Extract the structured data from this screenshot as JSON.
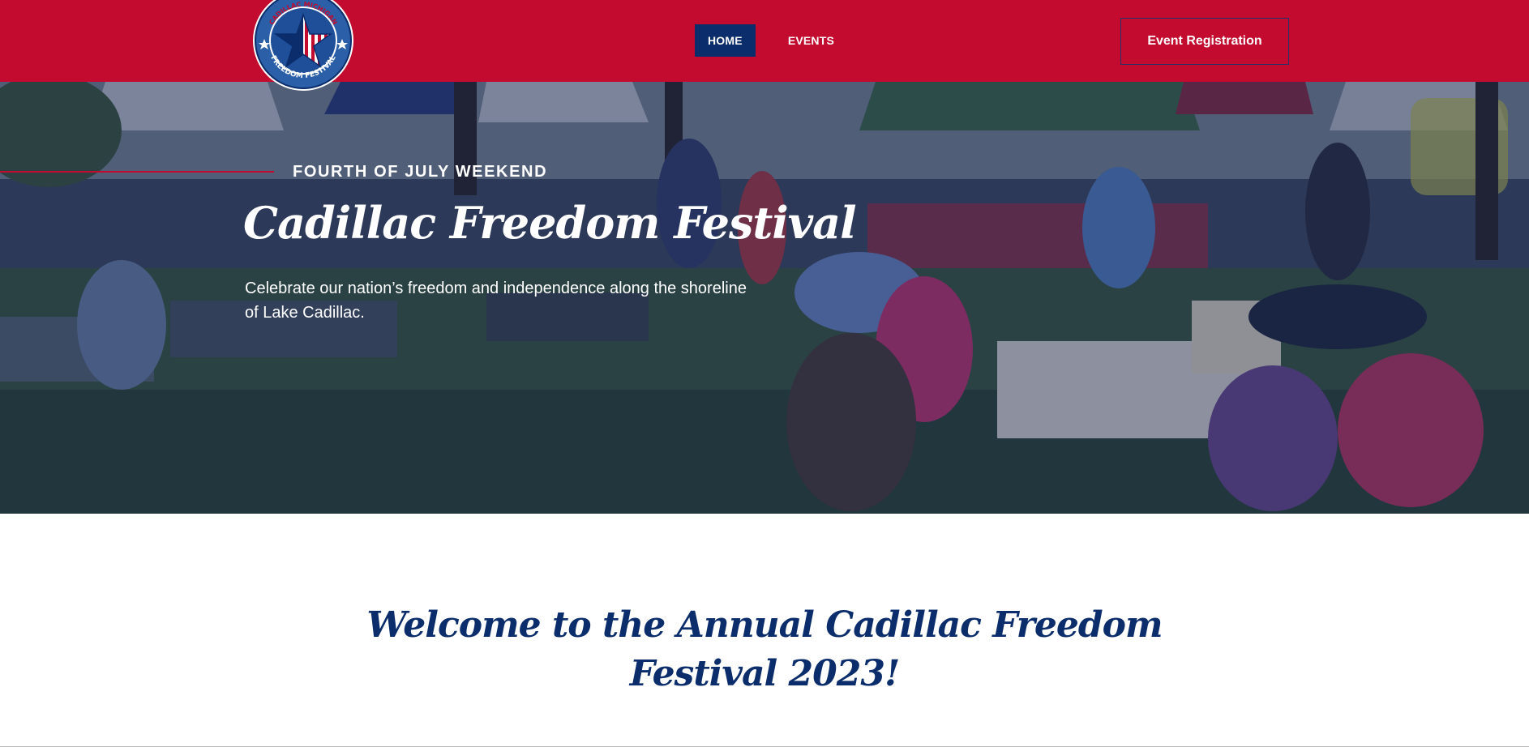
{
  "header": {
    "logo_text_top": "CADILLAC MICHIGAN",
    "logo_text_bottom": "FREEDOM FESTIVAL",
    "nav": [
      {
        "label": "HOME",
        "active": true
      },
      {
        "label": "EVENTS",
        "active": false
      }
    ],
    "cta_label": "Event Registration"
  },
  "hero": {
    "eyebrow": "FOURTH OF JULY WEEKEND",
    "title": "Cadillac Freedom Festival",
    "description": "Celebrate our nation’s freedom and independence along the shoreline of Lake Cadillac."
  },
  "welcome": {
    "title": "Welcome to the Annual Cadillac Freedom Festival 2023!"
  },
  "colors": {
    "header_red": "#c20b2f",
    "navy": "#0b2d6b",
    "white": "#ffffff"
  },
  "icons": {
    "logo": "festival-star-logo"
  }
}
